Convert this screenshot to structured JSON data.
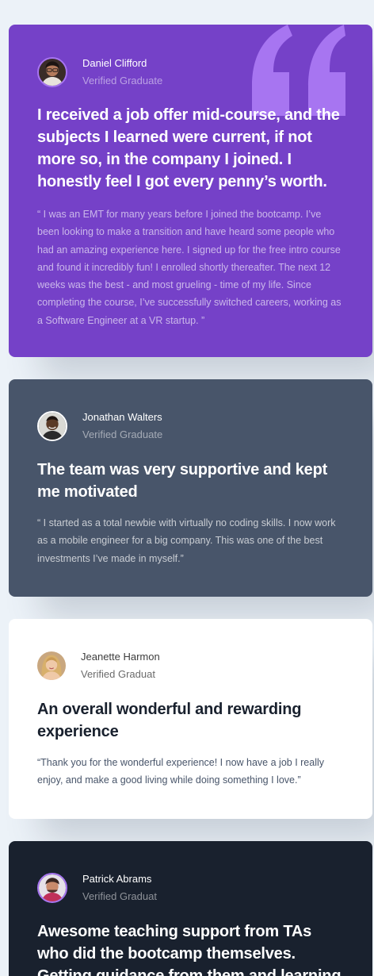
{
  "colors": {
    "background": "#ECF2F8",
    "moderate_violet": "#7541C8",
    "grayish_blue": "#48556A",
    "white": "#FFFFFF",
    "dark_blackish_blue": "#19212E",
    "light_violet": "#A775F1"
  },
  "testimonials": [
    {
      "name": "Daniel Clifford",
      "role": "Verified Graduate",
      "headline": "I received a job offer mid-course, and the subjects I learned were current, if not more so, in the company I joined. I honestly feel I got every penny’s worth.",
      "quote": "“ I was an EMT for many years before I joined the bootcamp. I’ve been looking to make a transition and have heard some people who had an amazing experience here. I signed up for the free intro course and found it incredibly fun! I enrolled shortly thereafter. The next 12 weeks was the best - and most grueling - time of my life. Since completing the course, I’ve successfully switched careers, working as a Software Engineer at a VR startup. ”",
      "decoration_icon": "quotation-mark-icon"
    },
    {
      "name": "Jonathan Walters",
      "role": "Verified Graduate",
      "headline": "The team was very supportive and kept me motivated",
      "quote": "“ I started as a total newbie with virtually no coding skills. I now work as a mobile engineer for a big company. This was one of the best investments I’ve made in myself.”"
    },
    {
      "name": "Jeanette Harmon",
      "role": "Verified Graduat",
      "headline": "An overall wonderful and rewarding experience",
      "quote": "“Thank you for the wonderful experience! I now have a job I really enjoy, and make a good living while doing something I love.”"
    },
    {
      "name": "Patrick Abrams",
      "role": "Verified Graduat",
      "headline": "Awesome teaching support from TAs who did the bootcamp themselves. Getting guidance from them and learning from"
    }
  ]
}
